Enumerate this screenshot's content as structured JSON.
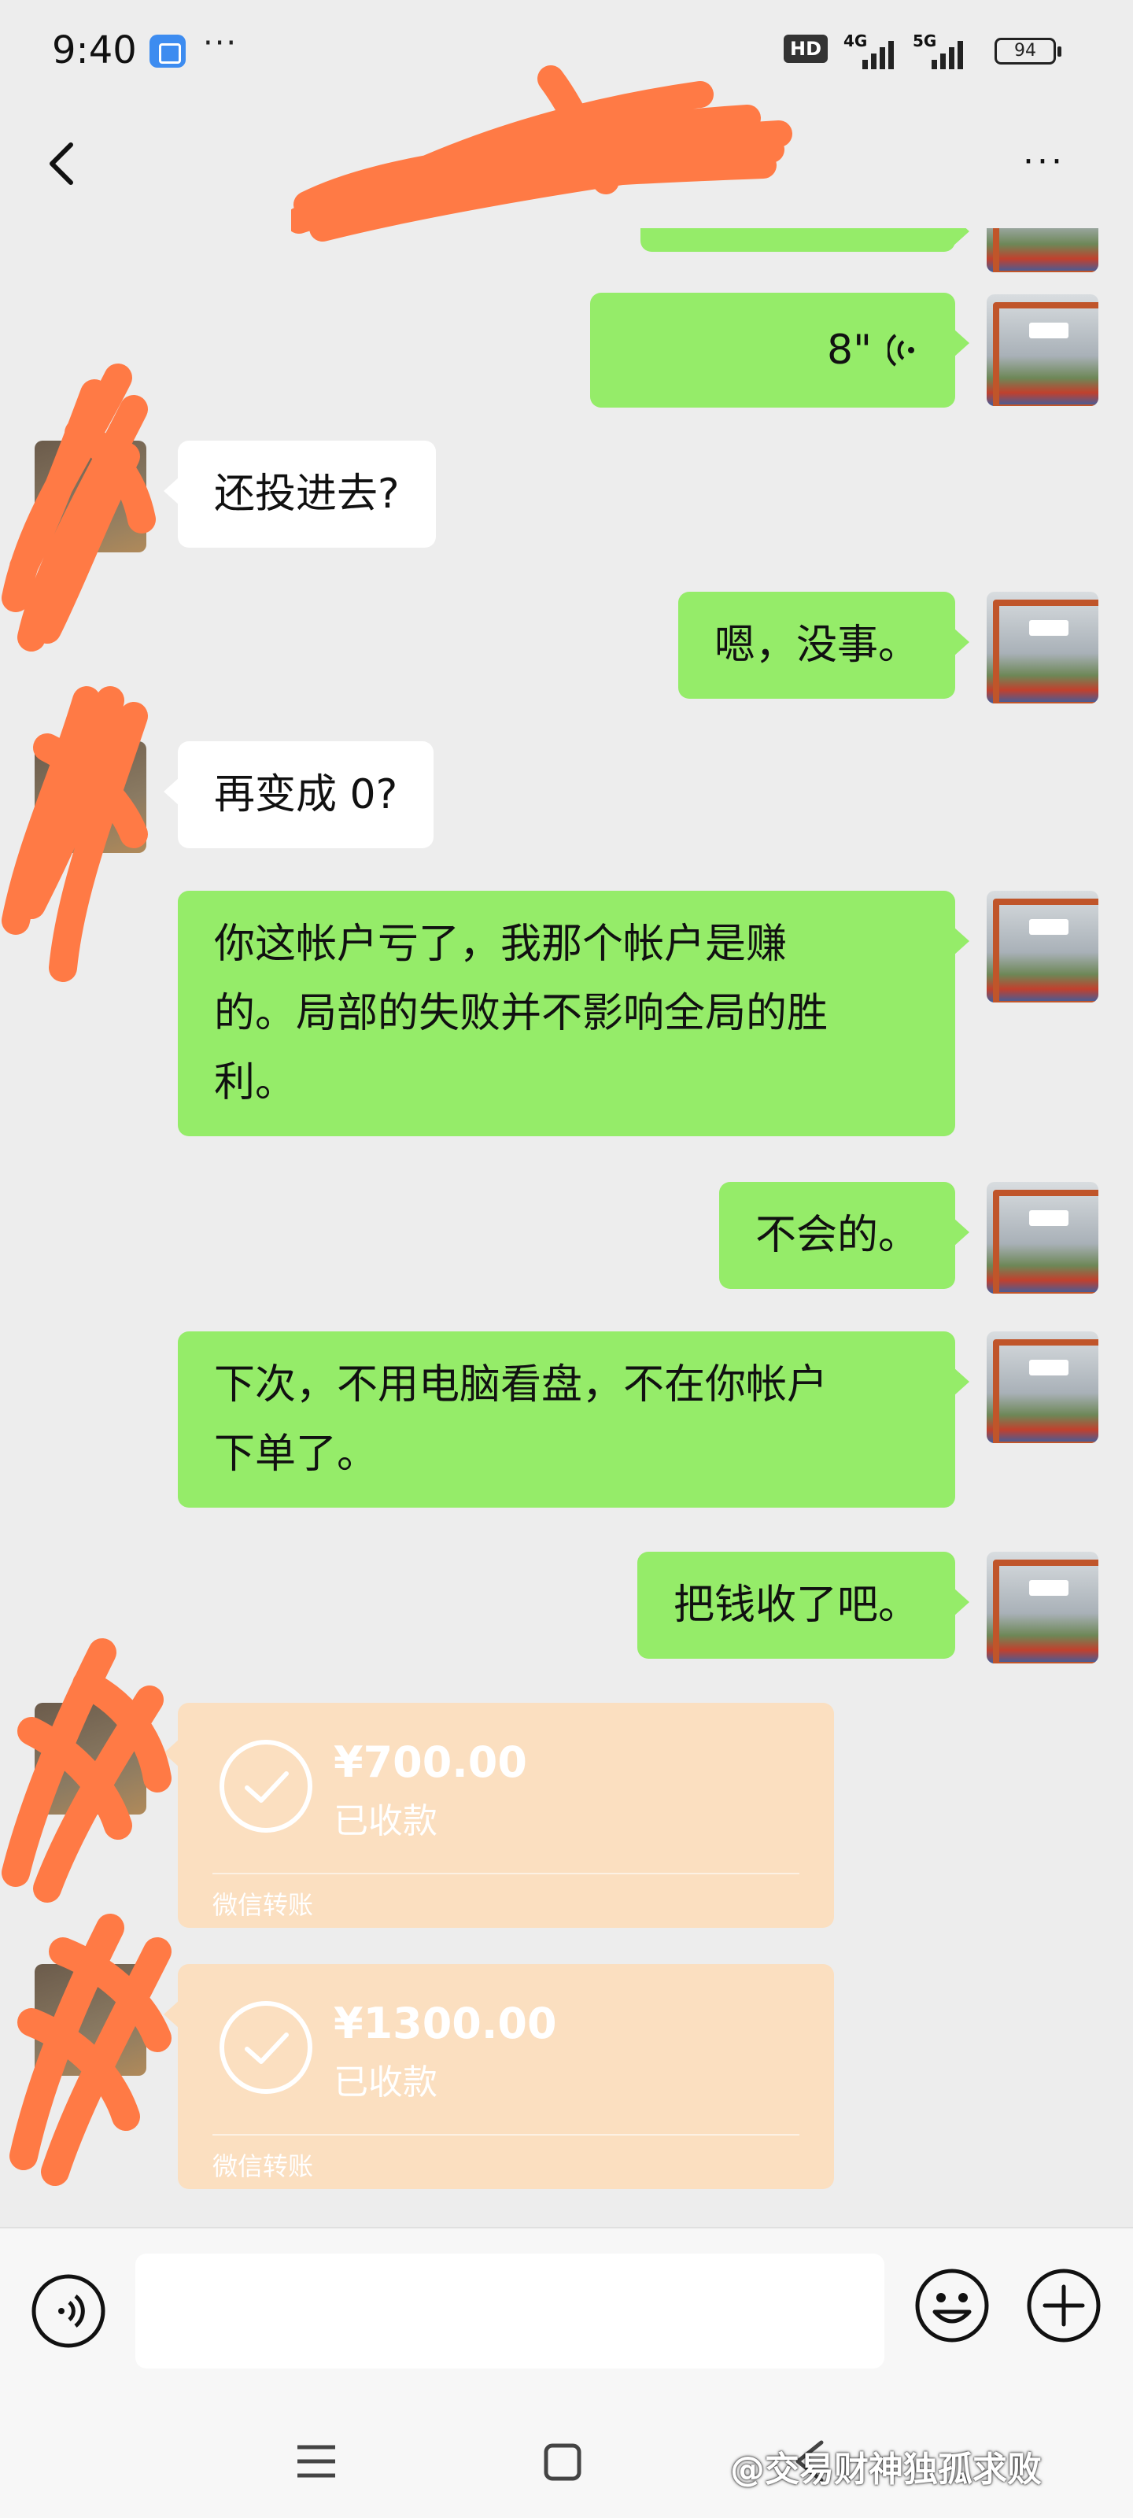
{
  "status_bar": {
    "time": "9:40",
    "more": "···",
    "hd_badge": "HD",
    "network_1": "4G",
    "network_2": "5G",
    "battery": "94"
  },
  "nav": {
    "title": "",
    "more": "···"
  },
  "messages": {
    "m0_voice_duration": "8\"",
    "m1_text": "还投进去?",
    "m2_text": "嗯，没事。",
    "m3_text": "再变成 0?",
    "m4_line1": "你这帐户亏了，我那个帐户是赚",
    "m4_line2": "的。局部的失败并不影响全局的胜",
    "m4_line3": "利。",
    "m5_text": "不会的。",
    "m6_line1": "下次，不用电脑看盘，不在你帐户",
    "m6_line2": "下单了。",
    "m7_text": "把钱收了吧。"
  },
  "transfers": [
    {
      "amount": "¥700.00",
      "status": "已收款",
      "label": "微信转账"
    },
    {
      "amount": "¥1300.00",
      "status": "已收款",
      "label": "微信转账"
    }
  ],
  "input": {
    "placeholder": ""
  },
  "watermark": "@交易财神独孤求败",
  "colors": {
    "outgoing_bubble": "#95ec69",
    "incoming_bubble": "#ffffff",
    "transfer_card": "#fbdfc0",
    "background": "#ededed",
    "redaction": "#ff7a45"
  }
}
